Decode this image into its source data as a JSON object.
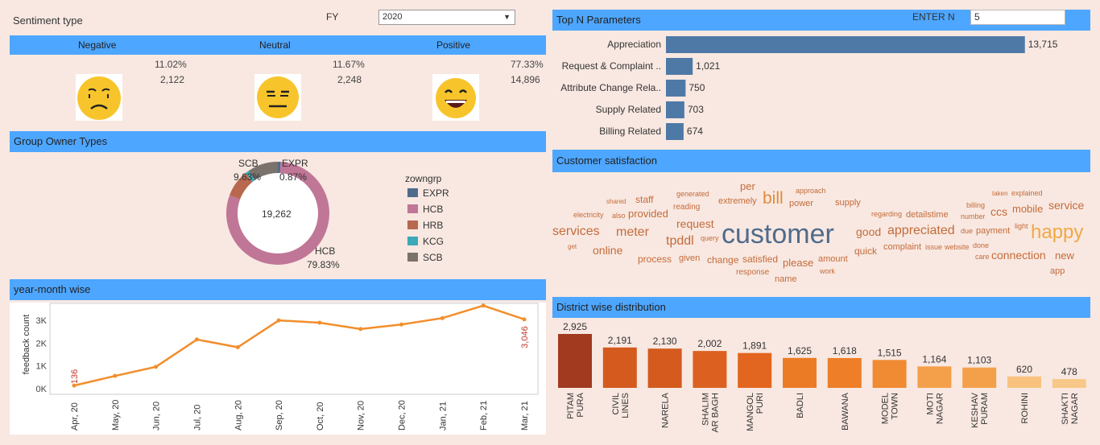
{
  "sentiment": {
    "title": "Sentiment type",
    "fy_label": "FY",
    "fy_value": "2020",
    "columns": [
      {
        "label": "Negative",
        "pct": "11.02%",
        "count": "2,122"
      },
      {
        "label": "Neutral",
        "pct": "11.67%",
        "count": "2,248"
      },
      {
        "label": "Positive",
        "pct": "77.33%",
        "count": "14,896"
      }
    ]
  },
  "group_owner": {
    "title": "Group Owner Types",
    "total": "19,262",
    "legend_title": "zowngrp",
    "legend": [
      {
        "label": "EXPR",
        "color": "#4e6b8c"
      },
      {
        "label": "HCB",
        "color": "#c07697"
      },
      {
        "label": "HRB",
        "color": "#b8684f"
      },
      {
        "label": "KCG",
        "color": "#3ba9b8"
      },
      {
        "label": "SCB",
        "color": "#7b726b"
      }
    ],
    "labels": {
      "scb_name": "SCB",
      "scb_pct": "9.63%",
      "expr_name": "EXPR",
      "expr_pct": "0.87%",
      "hcb_name": "HCB",
      "hcb_pct": "79.83%"
    }
  },
  "year_month": {
    "title": "year-month wise",
    "ylabel": "feedback count",
    "yticks": [
      "3K",
      "2K",
      "1K",
      "0K"
    ],
    "first_label": "136",
    "last_label": "3,046"
  },
  "top_n": {
    "title": "Top N Parameters",
    "enter_label": "ENTER N",
    "enter_value": "5"
  },
  "customer_satisfaction": {
    "title": "Customer satisfaction",
    "words": [
      {
        "t": "customer",
        "s": 34,
        "c": "#4e6b8c",
        "x": 896,
        "y": 274
      },
      {
        "t": "happy",
        "s": 24,
        "c": "#f0a844",
        "x": 1280,
        "y": 277
      },
      {
        "t": "bill",
        "s": 21,
        "c": "#e08a3c",
        "x": 947,
        "y": 236
      },
      {
        "t": "services",
        "s": 16,
        "c": "#c46b3a",
        "x": 686,
        "y": 280
      },
      {
        "t": "meter",
        "s": 16,
        "c": "#c46b3a",
        "x": 765,
        "y": 281
      },
      {
        "t": "tpddl",
        "s": 16,
        "c": "#c46b3a",
        "x": 827,
        "y": 292
      },
      {
        "t": "appreciated",
        "s": 16,
        "c": "#c46b3a",
        "x": 1102,
        "y": 279
      },
      {
        "t": "request",
        "s": 14,
        "c": "#c46b3a",
        "x": 840,
        "y": 271
      },
      {
        "t": "online",
        "s": 14,
        "c": "#c46b3a",
        "x": 736,
        "y": 304
      },
      {
        "t": "good",
        "s": 14,
        "c": "#c46b3a",
        "x": 1063,
        "y": 281
      },
      {
        "t": "ccs",
        "s": 14,
        "c": "#c46b3a",
        "x": 1230,
        "y": 256
      },
      {
        "t": "service",
        "s": 14,
        "c": "#c46b3a",
        "x": 1302,
        "y": 248
      },
      {
        "t": "connection",
        "s": 14,
        "c": "#c46b3a",
        "x": 1231,
        "y": 310
      },
      {
        "t": "provided",
        "s": 13,
        "c": "#c46b3a",
        "x": 780,
        "y": 259
      },
      {
        "t": "per",
        "s": 13,
        "c": "#c46b3a",
        "x": 919,
        "y": 225
      },
      {
        "t": "mobile",
        "s": 13,
        "c": "#c46b3a",
        "x": 1257,
        "y": 253
      },
      {
        "t": "please",
        "s": 13,
        "c": "#c46b3a",
        "x": 972,
        "y": 320
      },
      {
        "t": "new",
        "s": 13,
        "c": "#c46b3a",
        "x": 1310,
        "y": 311
      },
      {
        "t": "quick",
        "s": 12,
        "c": "#c46b3a",
        "x": 1061,
        "y": 306
      },
      {
        "t": "process",
        "s": 12,
        "c": "#c46b3a",
        "x": 792,
        "y": 316
      },
      {
        "t": "given",
        "s": 11,
        "c": "#c46b3a",
        "x": 843,
        "y": 316
      },
      {
        "t": "change",
        "s": 12,
        "c": "#c46b3a",
        "x": 878,
        "y": 317
      },
      {
        "t": "satisfied",
        "s": 12,
        "c": "#c46b3a",
        "x": 922,
        "y": 316
      },
      {
        "t": "staff",
        "s": 12,
        "c": "#c46b3a",
        "x": 789,
        "y": 242
      },
      {
        "t": "extremely",
        "s": 11,
        "c": "#c46b3a",
        "x": 892,
        "y": 245
      },
      {
        "t": "power",
        "s": 11,
        "c": "#c46b3a",
        "x": 980,
        "y": 248
      },
      {
        "t": "supply",
        "s": 11,
        "c": "#c46b3a",
        "x": 1037,
        "y": 247
      },
      {
        "t": "detailstime",
        "s": 11,
        "c": "#c46b3a",
        "x": 1125,
        "y": 262
      },
      {
        "t": "complaint",
        "s": 11,
        "c": "#c46b3a",
        "x": 1097,
        "y": 302
      },
      {
        "t": "payment",
        "s": 11,
        "c": "#c46b3a",
        "x": 1212,
        "y": 282
      },
      {
        "t": "amount",
        "s": 11,
        "c": "#c46b3a",
        "x": 1016,
        "y": 317
      },
      {
        "t": "response",
        "s": 10,
        "c": "#c46b3a",
        "x": 914,
        "y": 334
      },
      {
        "t": "name",
        "s": 11,
        "c": "#c46b3a",
        "x": 962,
        "y": 342
      },
      {
        "t": "app",
        "s": 11,
        "c": "#c46b3a",
        "x": 1304,
        "y": 332
      },
      {
        "t": "reading",
        "s": 10,
        "c": "#c46b3a",
        "x": 836,
        "y": 253
      },
      {
        "t": "generated",
        "s": 9,
        "c": "#c46b3a",
        "x": 840,
        "y": 237
      },
      {
        "t": "electricity",
        "s": 9,
        "c": "#c46b3a",
        "x": 712,
        "y": 263
      },
      {
        "t": "also",
        "s": 9,
        "c": "#c46b3a",
        "x": 760,
        "y": 264
      },
      {
        "t": "shared",
        "s": 8,
        "c": "#c46b3a",
        "x": 753,
        "y": 247
      },
      {
        "t": "approach",
        "s": 9,
        "c": "#c46b3a",
        "x": 988,
        "y": 233
      },
      {
        "t": "regarding",
        "s": 9,
        "c": "#c46b3a",
        "x": 1082,
        "y": 262
      },
      {
        "t": "billing",
        "s": 9,
        "c": "#c46b3a",
        "x": 1200,
        "y": 251
      },
      {
        "t": "number",
        "s": 9,
        "c": "#c46b3a",
        "x": 1193,
        "y": 265
      },
      {
        "t": "taken",
        "s": 8,
        "c": "#c46b3a",
        "x": 1232,
        "y": 237
      },
      {
        "t": "explained",
        "s": 9,
        "c": "#c46b3a",
        "x": 1256,
        "y": 236
      },
      {
        "t": "light",
        "s": 9,
        "c": "#c46b3a",
        "x": 1260,
        "y": 277
      },
      {
        "t": "due",
        "s": 9,
        "c": "#c46b3a",
        "x": 1193,
        "y": 283
      },
      {
        "t": "query",
        "s": 9,
        "c": "#c46b3a",
        "x": 870,
        "y": 292
      },
      {
        "t": "get",
        "s": 8,
        "c": "#c46b3a",
        "x": 705,
        "y": 303
      },
      {
        "t": "issue",
        "s": 9,
        "c": "#c46b3a",
        "x": 1149,
        "y": 303
      },
      {
        "t": "website",
        "s": 9,
        "c": "#c46b3a",
        "x": 1173,
        "y": 303
      },
      {
        "t": "done",
        "s": 9,
        "c": "#c46b3a",
        "x": 1208,
        "y": 301
      },
      {
        "t": "care",
        "s": 9,
        "c": "#c46b3a",
        "x": 1211,
        "y": 315
      },
      {
        "t": "work",
        "s": 9,
        "c": "#c46b3a",
        "x": 1018,
        "y": 333
      }
    ]
  },
  "district": {
    "title": "District wise distribution"
  },
  "chart_data": [
    {
      "type": "bar",
      "orientation": "horizontal",
      "title": "Top N Parameters",
      "categories": [
        "Appreciation",
        "Request & Complaint ..",
        "Attribute Change Rela..",
        "Supply Related",
        "Billing Related"
      ],
      "values": [
        13715,
        1021,
        750,
        703,
        674
      ],
      "value_labels": [
        "13,715",
        "1,021",
        "750",
        "703",
        "674"
      ],
      "color": "#4e79a7",
      "xlim": [
        0,
        14000
      ]
    },
    {
      "type": "pie",
      "title": "Group Owner Types",
      "categories": [
        "EXPR",
        "HCB",
        "HRB",
        "KCG",
        "SCB"
      ],
      "values": [
        0.87,
        79.83,
        8.5,
        1.17,
        9.63
      ]
    },
    {
      "type": "line",
      "title": "year-month wise",
      "ylabel": "feedback count",
      "x": [
        "Apr, 20",
        "May, 20",
        "Jun, 20",
        "Jul, 20",
        "Aug, 20",
        "Sep, 20",
        "Oct, 20",
        "Nov, 20",
        "Dec, 20",
        "Jan, 21",
        "Feb, 21",
        "Mar, 21"
      ],
      "values": [
        136,
        560,
        960,
        2160,
        1820,
        3000,
        2900,
        2620,
        2820,
        3100,
        3650,
        3046
      ],
      "ylim": [
        0,
        3500
      ],
      "yticks": [
        0,
        1000,
        2000,
        3000
      ],
      "color": "#f28e2b"
    },
    {
      "type": "bar",
      "title": "District wise distribution",
      "categories": [
        "PITAM PURA",
        "CIVIL LINES",
        "NARELA",
        "SHALIM AR BAGH",
        "MANGOL PURI",
        "BADLI",
        "BAWANA",
        "MODEL TOWN",
        "MOTI NAGAR",
        "KESHAV PURAM",
        "ROHINI",
        "SHAKTI NAGAR"
      ],
      "category_lines": [
        [
          "PITAM",
          "PURA"
        ],
        [
          "CIVIL",
          "LINES"
        ],
        [
          "NARELA"
        ],
        [
          "SHALIM",
          "AR BAGH"
        ],
        [
          "MANGOL",
          "PURI"
        ],
        [
          "BADLI"
        ],
        [
          "BAWANA"
        ],
        [
          "MODEL",
          "TOWN"
        ],
        [
          "MOTI",
          "NAGAR"
        ],
        [
          "KESHAV",
          "PURAM"
        ],
        [
          "ROHINI"
        ],
        [
          "SHAKTI",
          "NAGAR"
        ]
      ],
      "values": [
        2925,
        2191,
        2130,
        2002,
        1891,
        1625,
        1618,
        1515,
        1164,
        1103,
        620,
        478
      ],
      "value_labels": [
        "2,925",
        "2,191",
        "2,130",
        "2,002",
        "1,891",
        "1,625",
        "1,618",
        "1,515",
        "1,164",
        "1,103",
        "620",
        "478"
      ],
      "colors": [
        "#a13a1f",
        "#d45a1e",
        "#d45a1e",
        "#dc601f",
        "#e2661f",
        "#ec7b25",
        "#ee7e27",
        "#f08a33",
        "#f4a04a",
        "#f4a04a",
        "#f8c27e",
        "#f8c888"
      ]
    }
  ]
}
